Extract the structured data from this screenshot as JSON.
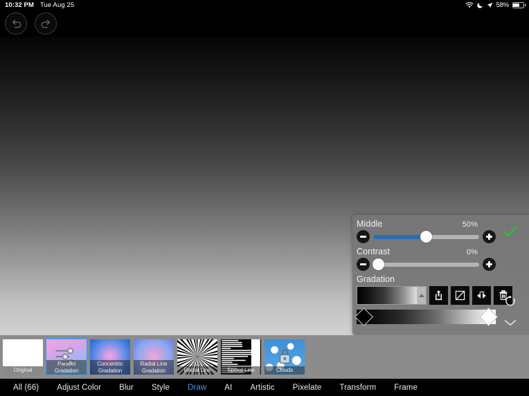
{
  "status_bar": {
    "time": "10:32 PM",
    "date": "Tue Aug 25",
    "battery_percent": "58%",
    "wifi_icon": "wifi-icon",
    "moon_icon": "do-not-disturb-icon",
    "location_icon": "location-arrow-icon",
    "battery_icon": "battery-icon"
  },
  "toolbar": {
    "undo_label": "Undo",
    "redo_label": "Redo"
  },
  "panel": {
    "controls": [
      {
        "name": "Middle",
        "value": "50%",
        "fill_percent": 50,
        "thumb_percent": 50,
        "has_fill": true
      },
      {
        "name": "Contrast",
        "value": "0%",
        "fill_percent": 0,
        "thumb_percent": 0,
        "has_fill": false
      }
    ],
    "gradation_label": "Gradation",
    "gradation_buttons": [
      {
        "name": "share-export-button",
        "label": "Export"
      },
      {
        "name": "curve-button",
        "label": "Curve"
      },
      {
        "name": "flip-mirror-button",
        "label": "Flip"
      },
      {
        "name": "delete-button",
        "label": "Delete"
      }
    ],
    "gradient_stops": [
      {
        "name": "black-stop",
        "color": "#000000",
        "position": 0
      },
      {
        "name": "white-stop",
        "color": "#ffffff",
        "position": 100
      }
    ],
    "apply_label": "Apply",
    "reset_label": "Reset",
    "collapse_label": "Collapse",
    "accent_color": "#2b6cb5",
    "apply_color": "#2fbb35",
    "panel_bg": "#767676"
  },
  "filmstrip": {
    "items": [
      {
        "label": "Original",
        "art": "art-original",
        "selected": false,
        "locked": false
      },
      {
        "label": "Parallel\nGradation",
        "art": "art-parallel",
        "selected": true,
        "locked": false
      },
      {
        "label": "Concentric\nGradation",
        "art": "art-concentric",
        "selected": false,
        "locked": false
      },
      {
        "label": "Radial Line\nGradation",
        "art": "art-radialgrad",
        "selected": false,
        "locked": false
      },
      {
        "label": "Radial Line",
        "art": "art-black",
        "selected": false,
        "locked": false
      },
      {
        "label": "Speed Line",
        "art": "art-black",
        "selected": false,
        "locked": false
      },
      {
        "label": "Clouds",
        "art": "art-clouds",
        "selected": false,
        "locked": true
      }
    ]
  },
  "tabs": [
    {
      "label": "All (66)",
      "active": false
    },
    {
      "label": "Adjust Color",
      "active": false
    },
    {
      "label": "Blur",
      "active": false
    },
    {
      "label": "Style",
      "active": false
    },
    {
      "label": "Draw",
      "active": true
    },
    {
      "label": "AI",
      "active": false
    },
    {
      "label": "Artistic",
      "active": false
    },
    {
      "label": "Pixelate",
      "active": false
    },
    {
      "label": "Transform",
      "active": false
    },
    {
      "label": "Frame",
      "active": false
    }
  ]
}
